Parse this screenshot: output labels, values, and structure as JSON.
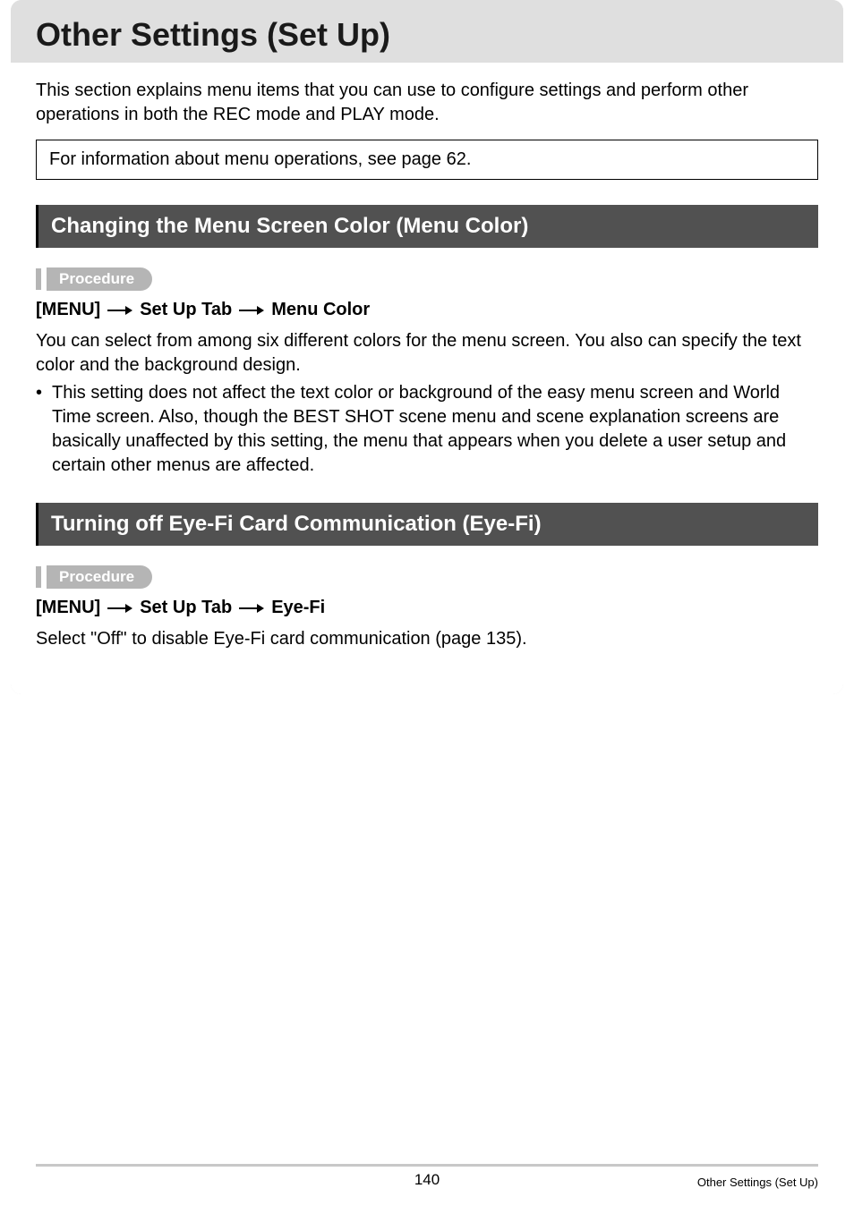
{
  "page": {
    "title": "Other Settings (Set Up)",
    "intro": "This section explains menu items that you can use to configure settings and perform other operations in both the REC mode and PLAY mode.",
    "note": "For information about menu operations, see page 62."
  },
  "sections": [
    {
      "header": "Changing the Menu Screen Color (Menu Color)",
      "procedure_label": "Procedure",
      "path": {
        "p1": "[MENU]",
        "p2": "Set Up Tab",
        "p3": "Menu Color"
      },
      "body_main": "You can select from among six different colors for the menu screen. You also can specify the text color and the background design.",
      "bullet_dot": "•",
      "bullet_text": "This setting does not affect the text color or background of the easy menu screen and World Time screen. Also, though the BEST SHOT scene menu and scene explanation screens are basically unaffected by this setting, the menu that appears when you delete a user setup and certain other menus are affected."
    },
    {
      "header": "Turning off Eye-Fi Card Communication (Eye-Fi)",
      "procedure_label": "Procedure",
      "path": {
        "p1": "[MENU]",
        "p2": "Set Up Tab",
        "p3": "Eye-Fi"
      },
      "body_main": "Select \"Off\" to disable Eye-Fi card communication (page 135)."
    }
  ],
  "footer": {
    "page_number": "140",
    "label": "Other Settings (Set Up)"
  }
}
